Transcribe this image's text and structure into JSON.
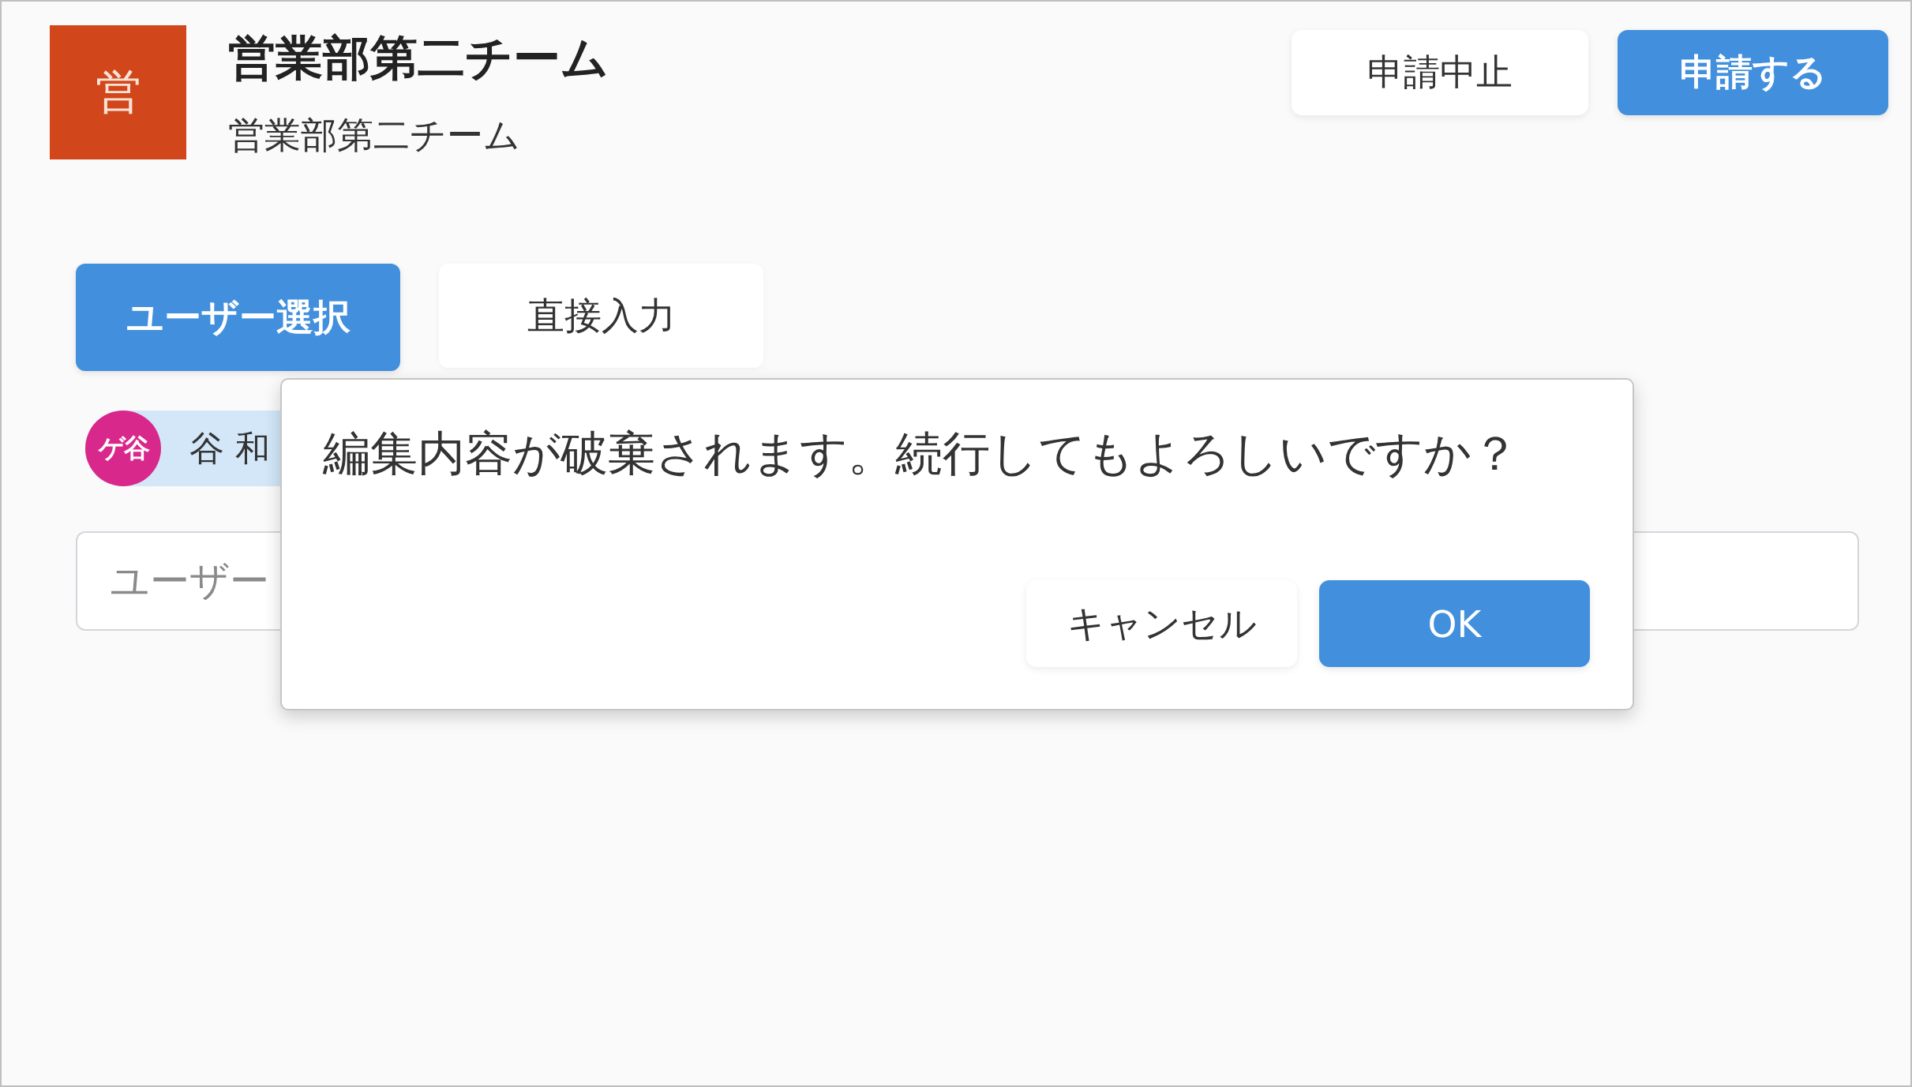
{
  "team": {
    "avatar_text": "営",
    "name": "営業部第二チーム",
    "subtitle": "営業部第二チーム"
  },
  "header_buttons": [
    {
      "label": "申請中止",
      "kind": "secondary"
    },
    {
      "label": "申請する",
      "kind": "primary"
    }
  ],
  "tabs": [
    {
      "label": "ユーザー選択",
      "selected": true
    },
    {
      "label": "直接入力",
      "selected": false
    }
  ],
  "selected_users": [
    {
      "avatar_text": "ゲ谷",
      "name": "谷 和",
      "color": "#d9288c"
    }
  ],
  "user_search": {
    "placeholder": "ユーザー"
  },
  "dialog": {
    "message": "編集内容が破棄されます。続行してもよろしいですか？",
    "buttons": [
      {
        "label": "キャンセル",
        "kind": "secondary"
      },
      {
        "label": "OK",
        "kind": "primary"
      }
    ]
  }
}
